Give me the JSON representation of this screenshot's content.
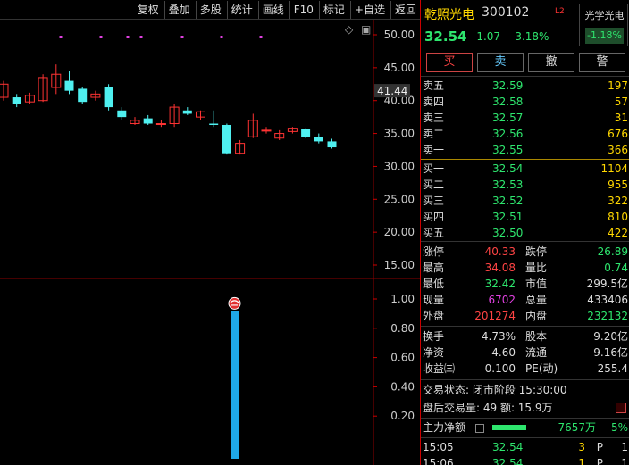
{
  "toolbar": [
    "复权",
    "叠加",
    "多股",
    "统计",
    "画线",
    "F10",
    "标记",
    "+自选",
    "返回"
  ],
  "kline": {
    "y_ticks": [
      "50.00",
      "45.00",
      "40.00",
      "35.00",
      "30.00",
      "25.00",
      "20.00",
      "15.00"
    ],
    "current_price_label": "41.44",
    "candles": [
      {
        "o": 40.5,
        "c": 42.5,
        "h": 43.0,
        "l": 40.0
      },
      {
        "o": 40.5,
        "c": 39.5,
        "h": 41.0,
        "l": 39.0
      },
      {
        "o": 39.8,
        "c": 40.8,
        "h": 41.2,
        "l": 39.5
      },
      {
        "o": 40.0,
        "c": 43.5,
        "h": 44.0,
        "l": 39.8
      },
      {
        "o": 42.0,
        "c": 44.0,
        "h": 45.5,
        "l": 41.0
      },
      {
        "o": 43.0,
        "c": 41.5,
        "h": 44.5,
        "l": 41.0
      },
      {
        "o": 41.8,
        "c": 39.8,
        "h": 42.0,
        "l": 39.5
      },
      {
        "o": 40.5,
        "c": 41.0,
        "h": 41.5,
        "l": 40.0
      },
      {
        "o": 42.0,
        "c": 39.0,
        "h": 42.5,
        "l": 38.5
      },
      {
        "o": 38.5,
        "c": 37.5,
        "h": 39.0,
        "l": 37.0
      },
      {
        "o": 36.5,
        "c": 37.0,
        "h": 37.5,
        "l": 36.3
      },
      {
        "o": 37.3,
        "c": 36.5,
        "h": 37.8,
        "l": 36.3
      },
      {
        "o": 36.5,
        "c": 36.5,
        "h": 37.0,
        "l": 36.0
      },
      {
        "o": 36.5,
        "c": 39.0,
        "h": 39.5,
        "l": 36.0
      },
      {
        "o": 38.5,
        "c": 38.0,
        "h": 39.0,
        "l": 37.8
      },
      {
        "o": 37.5,
        "c": 38.3,
        "h": 38.5,
        "l": 37.0
      },
      {
        "o": 36.5,
        "c": 36.3,
        "h": 38.5,
        "l": 36.0
      },
      {
        "o": 36.3,
        "c": 32.0,
        "h": 36.5,
        "l": 31.8
      },
      {
        "o": 32.0,
        "c": 33.5,
        "h": 34.0,
        "l": 31.8
      },
      {
        "o": 34.5,
        "c": 37.0,
        "h": 38.0,
        "l": 34.3
      },
      {
        "o": 35.5,
        "c": 35.5,
        "h": 36.0,
        "l": 35.0
      },
      {
        "o": 34.3,
        "c": 35.0,
        "h": 35.5,
        "l": 34.0
      },
      {
        "o": 35.3,
        "c": 35.8,
        "h": 36.0,
        "l": 35.0
      },
      {
        "o": 35.7,
        "c": 34.5,
        "h": 35.8,
        "l": 34.3
      },
      {
        "o": 34.5,
        "c": 33.8,
        "h": 35.0,
        "l": 33.5
      },
      {
        "o": 33.8,
        "c": 32.9,
        "h": 34.2,
        "l": 32.7
      }
    ]
  },
  "indicator": {
    "y_ticks": [
      "1.00",
      "0.80",
      "0.60",
      "0.40",
      "0.20"
    ],
    "bar_value": 0.92,
    "marker_value": 0.97
  },
  "stock": {
    "name": "乾照光电",
    "code": "300102",
    "badge": "L2",
    "price": "32.54",
    "change": "-1.07",
    "change_pct": "-3.18%",
    "sector_name": "光学光电",
    "sector_change": "-1.18%"
  },
  "trade_buttons": [
    "买",
    "卖",
    "撤",
    "警"
  ],
  "sell_orders": [
    {
      "label": "卖五",
      "price": "32.59",
      "vol": "197"
    },
    {
      "label": "卖四",
      "price": "32.58",
      "vol": "57"
    },
    {
      "label": "卖三",
      "price": "32.57",
      "vol": "31"
    },
    {
      "label": "卖二",
      "price": "32.56",
      "vol": "676"
    },
    {
      "label": "卖一",
      "price": "32.55",
      "vol": "366"
    }
  ],
  "buy_orders": [
    {
      "label": "买一",
      "price": "32.54",
      "vol": "1104"
    },
    {
      "label": "买二",
      "price": "32.53",
      "vol": "955"
    },
    {
      "label": "买三",
      "price": "32.52",
      "vol": "322"
    },
    {
      "label": "买四",
      "price": "32.51",
      "vol": "810"
    },
    {
      "label": "买五",
      "price": "32.50",
      "vol": "422"
    }
  ],
  "stats": {
    "limit_up_label": "涨停",
    "limit_up": "40.33",
    "limit_down_label": "跌停",
    "limit_down": "26.89",
    "high_label": "最高",
    "high": "34.08",
    "vol_ratio_label": "量比",
    "vol_ratio": "0.74",
    "low_label": "最低",
    "low": "32.42",
    "mkt_cap_label": "市值",
    "mkt_cap": "299.5亿",
    "cur_vol_label": "现量",
    "cur_vol": "6702",
    "total_vol_label": "总量",
    "total_vol": "433406",
    "outer_label": "外盘",
    "outer": "201274",
    "inner_label": "内盘",
    "inner": "232132",
    "turnover_label": "换手",
    "turnover": "4.73%",
    "share_cap_label": "股本",
    "share_cap": "9.20亿",
    "nav_label": "净资",
    "nav": "4.60",
    "float_label": "流通",
    "float": "9.16亿",
    "eps_label": "收益㈢",
    "eps": "0.100",
    "pe_label": "PE(动)",
    "pe": "255.4"
  },
  "status": {
    "state_line": "交易状态: 闭市阶段 15:30:00",
    "after_line": "盘后交易量: 49  额: 15.9万",
    "flow_label": "主力净额",
    "flow_value": "-7657万",
    "flow_pct": "-5%"
  },
  "ticks": [
    {
      "time": "15:05",
      "price": "32.54",
      "vol": "3",
      "side": "P",
      "count": "1"
    },
    {
      "time": "15:06",
      "price": "32.54",
      "vol": "1",
      "side": "P",
      "count": "1"
    }
  ]
}
